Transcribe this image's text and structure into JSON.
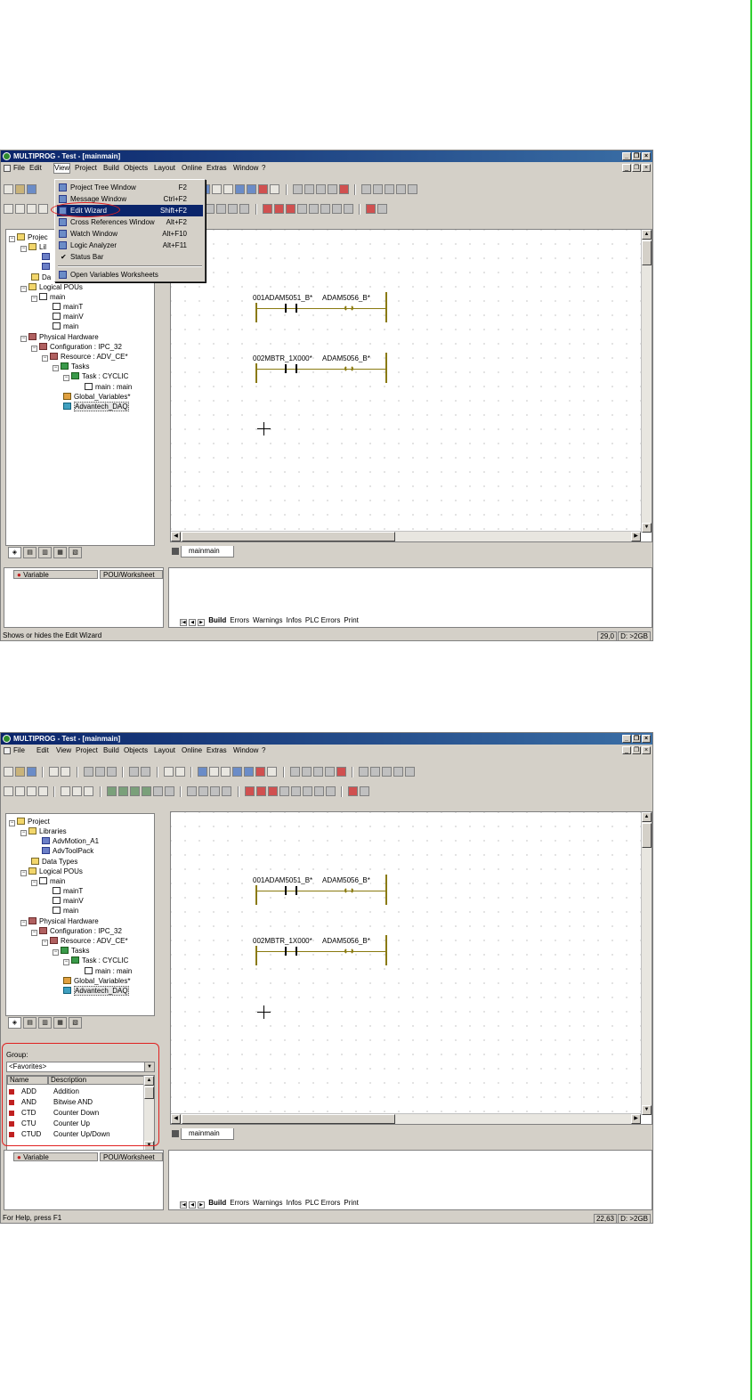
{
  "window1": {
    "title": "MULTIPROG - Test - [mainmain]",
    "menu": [
      "File",
      "Edit",
      "View",
      "Project",
      "Build",
      "Objects",
      "Layout",
      "Online",
      "Extras",
      "Window",
      "?"
    ],
    "view_menu": {
      "items": [
        {
          "label": "Project Tree Window",
          "shortcut": "F2"
        },
        {
          "label": "Message Window",
          "shortcut": "Ctrl+F2"
        },
        {
          "label": "Edit Wizard",
          "shortcut": "Shift+F2"
        },
        {
          "label": "Cross References Window",
          "shortcut": "Alt+F2"
        },
        {
          "label": "Watch Window",
          "shortcut": "Alt+F10"
        },
        {
          "label": "Logic Analyzer",
          "shortcut": "Alt+F11"
        },
        {
          "label": "Status Bar",
          "shortcut": ""
        },
        {
          "label": "Open Variables Worksheets",
          "shortcut": ""
        }
      ]
    },
    "tree_partial": [
      "Projec",
      "Lil",
      "Da",
      "Logical POUs",
      "main",
      "mainT",
      "mainV",
      "main",
      "Physical Hardware",
      "Configuration : IPC_32",
      "Resource : ADV_CE*",
      "Tasks",
      "Task : CYCLIC",
      "main : main",
      "Global_Variables*",
      "Advantech_DAQ"
    ],
    "rung1": {
      "contact": "001ADAM5051_B*",
      "coil": "ADAM5056_B*"
    },
    "rung2": {
      "contact": "002MBTR_1X000*",
      "coil": "ADAM5056_B*"
    },
    "editor_tab": "mainmain",
    "var_headers": {
      "variable": "Variable",
      "pou": "POU/Worksheet"
    },
    "output_tabs": [
      "Build",
      "Errors",
      "Warnings",
      "Infos",
      "PLC Errors",
      "Print"
    ],
    "status": {
      "text": "Shows or hides the Edit Wizard",
      "coords": "29,0",
      "mem": "D: >2GB"
    }
  },
  "window2": {
    "title": "MULTIPROG - Test - [mainmain]",
    "menu": [
      "File",
      "Edit",
      "View",
      "Project",
      "Build",
      "Objects",
      "Layout",
      "Online",
      "Extras",
      "Window",
      "?"
    ],
    "tree": [
      "Project",
      "Libraries",
      "AdvMotion_A1",
      "AdvToolPack",
      "Data Types",
      "Logical POUs",
      "main",
      "mainT",
      "mainV",
      "main",
      "Physical Hardware",
      "Configuration : IPC_32",
      "Resource : ADV_CE*",
      "Tasks",
      "Task : CYCLIC",
      "main : main",
      "Global_Variables*",
      "Advantech_DAQ"
    ],
    "edit_wizard": {
      "group_label": "Group:",
      "group_value": "<Favorites>",
      "col_name": "Name",
      "col_desc": "Description",
      "rows": [
        {
          "name": "ADD",
          "desc": "Addition"
        },
        {
          "name": "AND",
          "desc": "Bitwise AND"
        },
        {
          "name": "CTD",
          "desc": "Counter Down"
        },
        {
          "name": "CTU",
          "desc": "Counter Up"
        },
        {
          "name": "CTUD",
          "desc": "Counter Up/Down"
        }
      ]
    },
    "rung1": {
      "contact": "001ADAM5051_B*",
      "coil": "ADAM5056_B*"
    },
    "rung2": {
      "contact": "002MBTR_1X000*",
      "coil": "ADAM5056_B*"
    },
    "editor_tab": "mainmain",
    "var_headers": {
      "variable": "Variable",
      "pou": "POU/Worksheet"
    },
    "output_tabs": [
      "Build",
      "Errors",
      "Warnings",
      "Infos",
      "PLC Errors",
      "Print"
    ],
    "status": {
      "text": "For Help, press F1",
      "coords": "22,63",
      "mem": "D: >2GB"
    }
  },
  "colors": {
    "title_bar": "#0a246a",
    "highlight": "#0a246a",
    "annotation": "#e02020",
    "ladder": "#8a7a10",
    "right_border": "#2fd12f"
  }
}
